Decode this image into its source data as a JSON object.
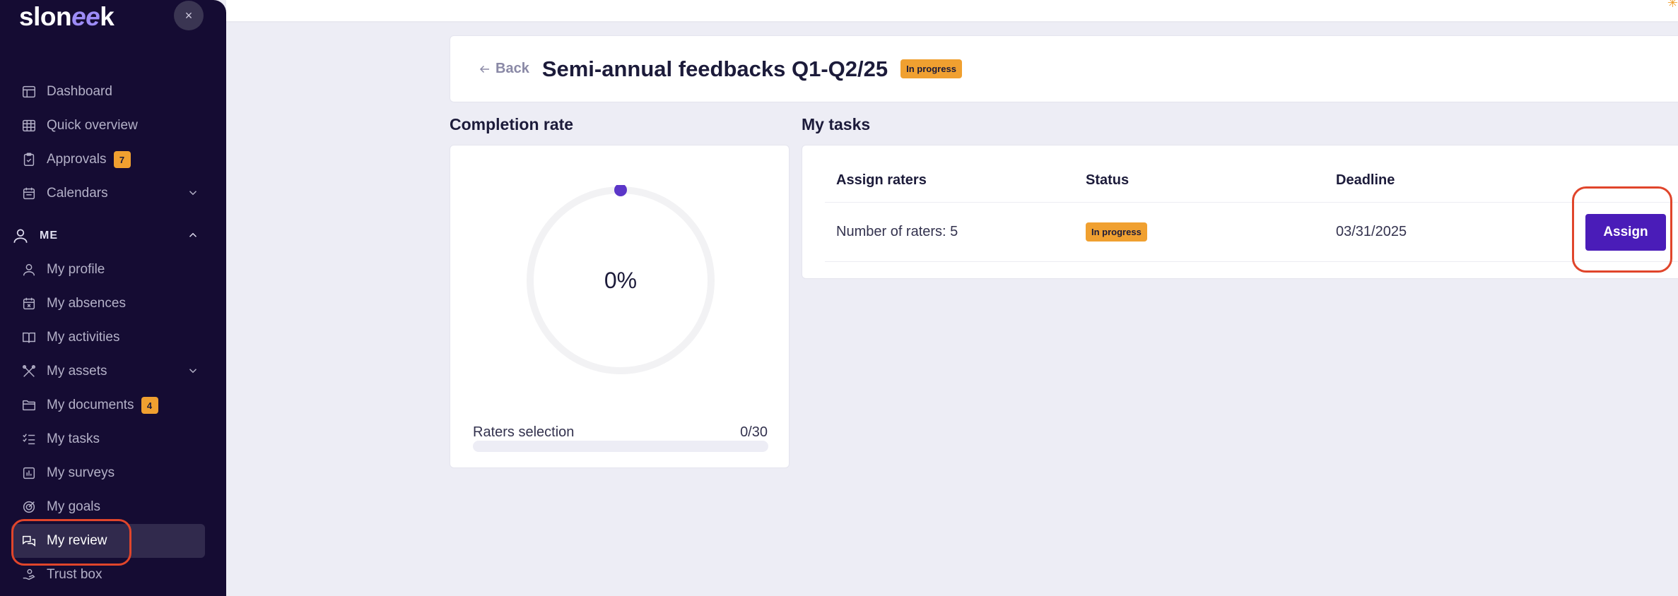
{
  "app": {
    "logo_prefix": "slon",
    "logo_loop": "ee",
    "logo_suffix": "k",
    "close_label": "×"
  },
  "sidebar": {
    "top_items": [
      {
        "label": "Dashboard",
        "icon": "dashboard-icon"
      },
      {
        "label": "Quick overview",
        "icon": "grid-icon"
      },
      {
        "label": "Approvals",
        "icon": "clipboard-icon",
        "badge": "7"
      },
      {
        "label": "Calendars",
        "icon": "calendar-icon",
        "has_chevron": true
      }
    ],
    "section_label": "ME",
    "me_items": [
      {
        "label": "My profile",
        "icon": "user-icon"
      },
      {
        "label": "My absences",
        "icon": "calendar-x-icon"
      },
      {
        "label": "My activities",
        "icon": "book-icon"
      },
      {
        "label": "My assets",
        "icon": "tools-icon",
        "has_chevron": true
      },
      {
        "label": "My documents",
        "icon": "folder-icon",
        "badge": "4"
      },
      {
        "label": "My tasks",
        "icon": "checklist-icon"
      },
      {
        "label": "My surveys",
        "icon": "bar-chart-icon"
      },
      {
        "label": "My goals",
        "icon": "target-icon"
      },
      {
        "label": "My review",
        "icon": "chat-bubbles-icon",
        "active": true
      },
      {
        "label": "Trust box",
        "icon": "hand-icon"
      }
    ]
  },
  "header": {
    "back_label": "Back",
    "title": "Semi-annual feedbacks Q1-Q2/25",
    "status": "In progress"
  },
  "completion": {
    "section_title": "Completion rate",
    "percent_label": "0%",
    "percent_value": 0,
    "raters_label": "Raters selection",
    "raters_value": "0/30",
    "raters_fraction": 0
  },
  "tasks": {
    "section_title": "My tasks",
    "columns": [
      "Assign raters",
      "Status",
      "Deadline"
    ],
    "rows": [
      {
        "task": "Number of raters: 5",
        "status": "In progress",
        "deadline": "03/31/2025",
        "action": "Assign"
      }
    ]
  },
  "colors": {
    "sidebar_bg": "#150c33",
    "accent": "#4a1cb8",
    "badge": "#f0a030",
    "highlight": "#e0452b"
  }
}
